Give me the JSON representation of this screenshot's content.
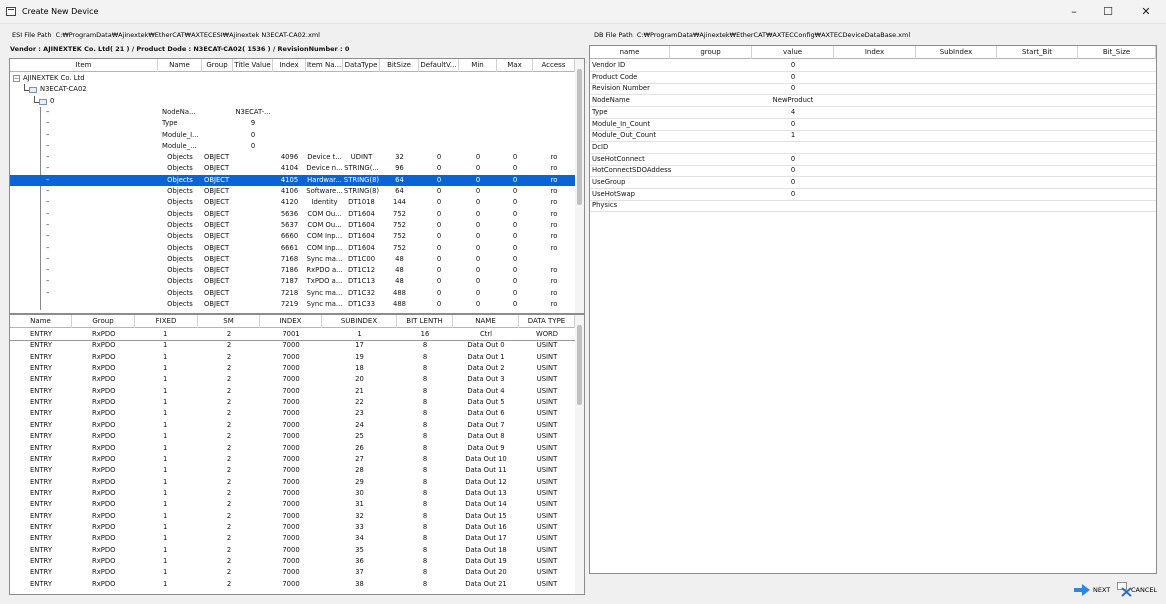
{
  "window": {
    "title": "Create New Device",
    "minimize": "–",
    "maximize": "☐",
    "close": "✕"
  },
  "esi": {
    "label": "ESI File Path",
    "path": "C:₩ProgramData₩Ajinextek₩EtherCAT₩AXTECESI₩Ajinextek N3ECAT-CA02.xml"
  },
  "db": {
    "label": "DB File Path",
    "path": "C:₩ProgramData₩Ajinextek₩EtherCAT₩AXTECConfig₩AXTECDeviceDataBase.xml"
  },
  "vendor_line": "Vendor : AJINEXTEK Co. Ltd( 21 ) / Product Dode : N3ECAT-CA02( 1536 ) / RevisionNumber : 0",
  "tree_table": {
    "columns": [
      "Item",
      "Name",
      "Group",
      "Title Value",
      "Index",
      "Item Na...",
      "DataType",
      "BitSize",
      "DefaultV...",
      "Min",
      "Max",
      "Access"
    ],
    "tree_nodes": [
      "AJINEXTEK Co. Ltd",
      "N3ECAT-CA02",
      "0"
    ],
    "rows": [
      {
        "item": "–",
        "name": "NodeNa...",
        "group": "",
        "title": "N3ECAT-...",
        "index": "",
        "itemname": "",
        "datatype": "",
        "bitsize": "",
        "default": "",
        "min": "",
        "max": "",
        "access": ""
      },
      {
        "item": "–",
        "name": "Type",
        "group": "",
        "title": "9",
        "index": "",
        "itemname": "",
        "datatype": "",
        "bitsize": "",
        "default": "",
        "min": "",
        "max": "",
        "access": ""
      },
      {
        "item": "–",
        "name": "Module_I...",
        "group": "",
        "title": "0",
        "index": "",
        "itemname": "",
        "datatype": "",
        "bitsize": "",
        "default": "",
        "min": "",
        "max": "",
        "access": ""
      },
      {
        "item": "–",
        "name": "Module_...",
        "group": "",
        "title": "0",
        "index": "",
        "itemname": "",
        "datatype": "",
        "bitsize": "",
        "default": "",
        "min": "",
        "max": "",
        "access": ""
      },
      {
        "item": "–",
        "name": "Objects",
        "group": "OBJECT",
        "title": "",
        "index": "4096",
        "itemname": "Device t...",
        "datatype": "UDINT",
        "bitsize": "32",
        "default": "0",
        "min": "0",
        "max": "0",
        "access": "ro"
      },
      {
        "item": "–",
        "name": "Objects",
        "group": "OBJECT",
        "title": "",
        "index": "4104",
        "itemname": "Device n...",
        "datatype": "STRING(...",
        "bitsize": "96",
        "default": "0",
        "min": "0",
        "max": "0",
        "access": "ro"
      },
      {
        "item": "–",
        "name": "Objects",
        "group": "OBJECT",
        "title": "",
        "index": "4105",
        "itemname": "Hardwar...",
        "datatype": "STRING(8)",
        "bitsize": "64",
        "default": "0",
        "min": "0",
        "max": "0",
        "access": "ro",
        "selected": true
      },
      {
        "item": "–",
        "name": "Objects",
        "group": "OBJECT",
        "title": "",
        "index": "4106",
        "itemname": "Software...",
        "datatype": "STRING(8)",
        "bitsize": "64",
        "default": "0",
        "min": "0",
        "max": "0",
        "access": "ro"
      },
      {
        "item": "–",
        "name": "Objects",
        "group": "OBJECT",
        "title": "",
        "index": "4120",
        "itemname": "Identity",
        "datatype": "DT1018",
        "bitsize": "144",
        "default": "0",
        "min": "0",
        "max": "0",
        "access": "ro"
      },
      {
        "item": "–",
        "name": "Objects",
        "group": "OBJECT",
        "title": "",
        "index": "5636",
        "itemname": "COM Ou...",
        "datatype": "DT1604",
        "bitsize": "752",
        "default": "0",
        "min": "0",
        "max": "0",
        "access": "ro"
      },
      {
        "item": "–",
        "name": "Objects",
        "group": "OBJECT",
        "title": "",
        "index": "5637",
        "itemname": "COM Ou...",
        "datatype": "DT1604",
        "bitsize": "752",
        "default": "0",
        "min": "0",
        "max": "0",
        "access": "ro"
      },
      {
        "item": "–",
        "name": "Objects",
        "group": "OBJECT",
        "title": "",
        "index": "6660",
        "itemname": "COM Inp...",
        "datatype": "DT1604",
        "bitsize": "752",
        "default": "0",
        "min": "0",
        "max": "0",
        "access": "ro"
      },
      {
        "item": "–",
        "name": "Objects",
        "group": "OBJECT",
        "title": "",
        "index": "6661",
        "itemname": "COM Inp...",
        "datatype": "DT1604",
        "bitsize": "752",
        "default": "0",
        "min": "0",
        "max": "0",
        "access": "ro"
      },
      {
        "item": "–",
        "name": "Objects",
        "group": "OBJECT",
        "title": "",
        "index": "7168",
        "itemname": "Sync ma...",
        "datatype": "DT1C00",
        "bitsize": "48",
        "default": "0",
        "min": "0",
        "max": "0",
        "access": ""
      },
      {
        "item": "–",
        "name": "Objects",
        "group": "OBJECT",
        "title": "",
        "index": "7186",
        "itemname": "RxPDO a...",
        "datatype": "DT1C12",
        "bitsize": "48",
        "default": "0",
        "min": "0",
        "max": "0",
        "access": "ro"
      },
      {
        "item": "–",
        "name": "Objects",
        "group": "OBJECT",
        "title": "",
        "index": "7187",
        "itemname": "TxPDO a...",
        "datatype": "DT1C13",
        "bitsize": "48",
        "default": "0",
        "min": "0",
        "max": "0",
        "access": "ro"
      },
      {
        "item": "–",
        "name": "Objects",
        "group": "OBJECT",
        "title": "",
        "index": "7218",
        "itemname": "Sync ma...",
        "datatype": "DT1C32",
        "bitsize": "488",
        "default": "0",
        "min": "0",
        "max": "0",
        "access": "ro"
      },
      {
        "item": "",
        "name": "Objects",
        "group": "OBJECT",
        "title": "",
        "index": "7219",
        "itemname": "Sync ma...",
        "datatype": "DT1C33",
        "bitsize": "488",
        "default": "0",
        "min": "0",
        "max": "0",
        "access": "ro"
      }
    ]
  },
  "pdo_table": {
    "columns": [
      "Name",
      "Group",
      "FIXED",
      "SM",
      "INDEX",
      "SUBINDEX",
      "BIT LENTH",
      "NAME",
      "DATA TYPE"
    ],
    "rows": [
      [
        "ENTRY",
        "RxPDO",
        "1",
        "2",
        "7001",
        "1",
        "16",
        "Ctrl",
        "WORD"
      ],
      [
        "ENTRY",
        "RxPDO",
        "1",
        "2",
        "7000",
        "17",
        "8",
        "Data Out 0",
        "USINT"
      ],
      [
        "ENTRY",
        "RxPDO",
        "1",
        "2",
        "7000",
        "19",
        "8",
        "Data Out 1",
        "USINT"
      ],
      [
        "ENTRY",
        "RxPDO",
        "1",
        "2",
        "7000",
        "18",
        "8",
        "Data Out 2",
        "USINT"
      ],
      [
        "ENTRY",
        "RxPDO",
        "1",
        "2",
        "7000",
        "20",
        "8",
        "Data Out 3",
        "USINT"
      ],
      [
        "ENTRY",
        "RxPDO",
        "1",
        "2",
        "7000",
        "21",
        "8",
        "Data Out 4",
        "USINT"
      ],
      [
        "ENTRY",
        "RxPDO",
        "1",
        "2",
        "7000",
        "22",
        "8",
        "Data Out 5",
        "USINT"
      ],
      [
        "ENTRY",
        "RxPDO",
        "1",
        "2",
        "7000",
        "23",
        "8",
        "Data Out 6",
        "USINT"
      ],
      [
        "ENTRY",
        "RxPDO",
        "1",
        "2",
        "7000",
        "24",
        "8",
        "Data Out 7",
        "USINT"
      ],
      [
        "ENTRY",
        "RxPDO",
        "1",
        "2",
        "7000",
        "25",
        "8",
        "Data Out 8",
        "USINT"
      ],
      [
        "ENTRY",
        "RxPDO",
        "1",
        "2",
        "7000",
        "26",
        "8",
        "Data Out 9",
        "USINT"
      ],
      [
        "ENTRY",
        "RxPDO",
        "1",
        "2",
        "7000",
        "27",
        "8",
        "Data Out 10",
        "USINT"
      ],
      [
        "ENTRY",
        "RxPDO",
        "1",
        "2",
        "7000",
        "28",
        "8",
        "Data Out 11",
        "USINT"
      ],
      [
        "ENTRY",
        "RxPDO",
        "1",
        "2",
        "7000",
        "29",
        "8",
        "Data Out 12",
        "USINT"
      ],
      [
        "ENTRY",
        "RxPDO",
        "1",
        "2",
        "7000",
        "30",
        "8",
        "Data Out 13",
        "USINT"
      ],
      [
        "ENTRY",
        "RxPDO",
        "1",
        "2",
        "7000",
        "31",
        "8",
        "Data Out 14",
        "USINT"
      ],
      [
        "ENTRY",
        "RxPDO",
        "1",
        "2",
        "7000",
        "32",
        "8",
        "Data Out 15",
        "USINT"
      ],
      [
        "ENTRY",
        "RxPDO",
        "1",
        "2",
        "7000",
        "33",
        "8",
        "Data Out 16",
        "USINT"
      ],
      [
        "ENTRY",
        "RxPDO",
        "1",
        "2",
        "7000",
        "34",
        "8",
        "Data Out 17",
        "USINT"
      ],
      [
        "ENTRY",
        "RxPDO",
        "1",
        "2",
        "7000",
        "35",
        "8",
        "Data Out 18",
        "USINT"
      ],
      [
        "ENTRY",
        "RxPDO",
        "1",
        "2",
        "7000",
        "36",
        "8",
        "Data Out 19",
        "USINT"
      ],
      [
        "ENTRY",
        "RxPDO",
        "1",
        "2",
        "7000",
        "37",
        "8",
        "Data Out 20",
        "USINT"
      ],
      [
        "ENTRY",
        "RxPDO",
        "1",
        "2",
        "7000",
        "38",
        "8",
        "Data Out 21",
        "USINT"
      ]
    ]
  },
  "prop_table": {
    "columns": [
      "name",
      "group",
      "value",
      "Index",
      "SubIndex",
      "Start_Bit",
      "Bit_Size"
    ],
    "rows": [
      {
        "name": "Vendor ID",
        "value": "0"
      },
      {
        "name": "Product Code",
        "value": "0"
      },
      {
        "name": "Revision Number",
        "value": "0"
      },
      {
        "name": "NodeName",
        "value": "NewProduct"
      },
      {
        "name": "Type",
        "value": "4"
      },
      {
        "name": "Module_In_Count",
        "value": "0"
      },
      {
        "name": "Module_Out_Count",
        "value": "1"
      },
      {
        "name": "DcID",
        "value": ""
      },
      {
        "name": "UseHotConnect",
        "value": "0"
      },
      {
        "name": "HotConnectSDOAddess",
        "value": "0"
      },
      {
        "name": "UseGroup",
        "value": "0"
      },
      {
        "name": "UseHotSwap",
        "value": "0"
      },
      {
        "name": "Physics",
        "value": ""
      }
    ]
  },
  "buttons": {
    "next": "NEXT",
    "cancel": "CANCEL",
    "next_icon": "arrow-right-icon",
    "cancel_icon": "cancel-x-icon"
  },
  "colors": {
    "selection": "#0a64d6",
    "next_arrow": "#2e86de",
    "cancel_x": "#2d6cc4"
  }
}
